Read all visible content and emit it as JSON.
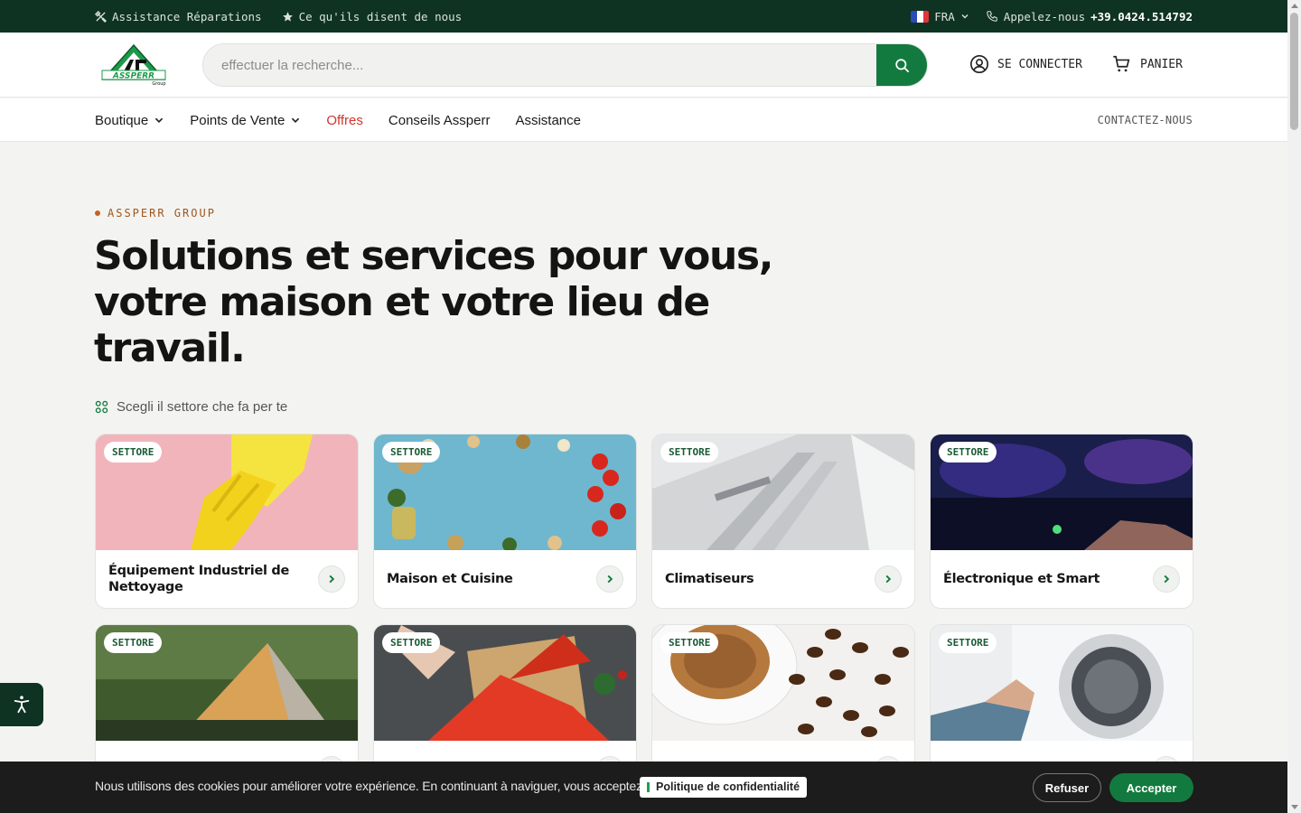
{
  "topbar": {
    "repairs": "Assistance Réparations",
    "reviews": "Ce qu'ils disent de nous",
    "language": "FRA",
    "call_label": "Appelez-nous",
    "phone": "+39.0424.514792"
  },
  "header": {
    "logo_text": "ASSPERR",
    "logo_sub": "Group",
    "search_placeholder": "effectuer la recherche...",
    "login": "SE CONNECTER",
    "cart": "PANIER"
  },
  "nav": {
    "items": [
      {
        "label": "Boutique",
        "dropdown": true
      },
      {
        "label": "Points de Vente",
        "dropdown": true
      },
      {
        "label": "Offres",
        "dropdown": false
      },
      {
        "label": "Conseils Assperr",
        "dropdown": false
      },
      {
        "label": "Assistance",
        "dropdown": false
      }
    ],
    "contact": "CONTACTEZ-NOUS"
  },
  "hero": {
    "eyebrow": "ASSPERR GROUP",
    "title": "Solutions et services pour vous, votre maison et votre lieu de travail.",
    "sector_label": "Scegli il settore che fa per te"
  },
  "sectors": [
    {
      "badge": "SETTORE",
      "title": "Équipement Industriel de Nettoyage",
      "image": "yellow-glove-on-pink"
    },
    {
      "badge": "SETTORE",
      "title": "Maison et Cuisine",
      "image": "food-ingredients-on-blue"
    },
    {
      "badge": "SETTORE",
      "title": "Climatiseurs",
      "image": "air-conditioner-louvers"
    },
    {
      "badge": "SETTORE",
      "title": "Électronique et Smart",
      "image": "keyboard-rgb-lights"
    },
    {
      "badge": "SETTORE",
      "title": "",
      "image": "tent-camping"
    },
    {
      "badge": "SETTORE",
      "title": "",
      "image": "gift-red-ribbon"
    },
    {
      "badge": "SETTORE",
      "title": "",
      "image": "coffee-cup-beans"
    },
    {
      "badge": "SETTORE",
      "title": "",
      "image": "washing-machine"
    }
  ],
  "cookie": {
    "text": "Nous utilisons des cookies pour améliorer votre expérience. En continuant à naviguer, vous acceptez notre",
    "policy": "Politique de confidentialité",
    "refuse": "Refuser",
    "accept": "Accepter"
  },
  "colors": {
    "brand_dark": "#0f3322",
    "brand_green": "#137a3f",
    "offer_red": "#d0342c",
    "eyebrow_orange": "#a0561e"
  }
}
